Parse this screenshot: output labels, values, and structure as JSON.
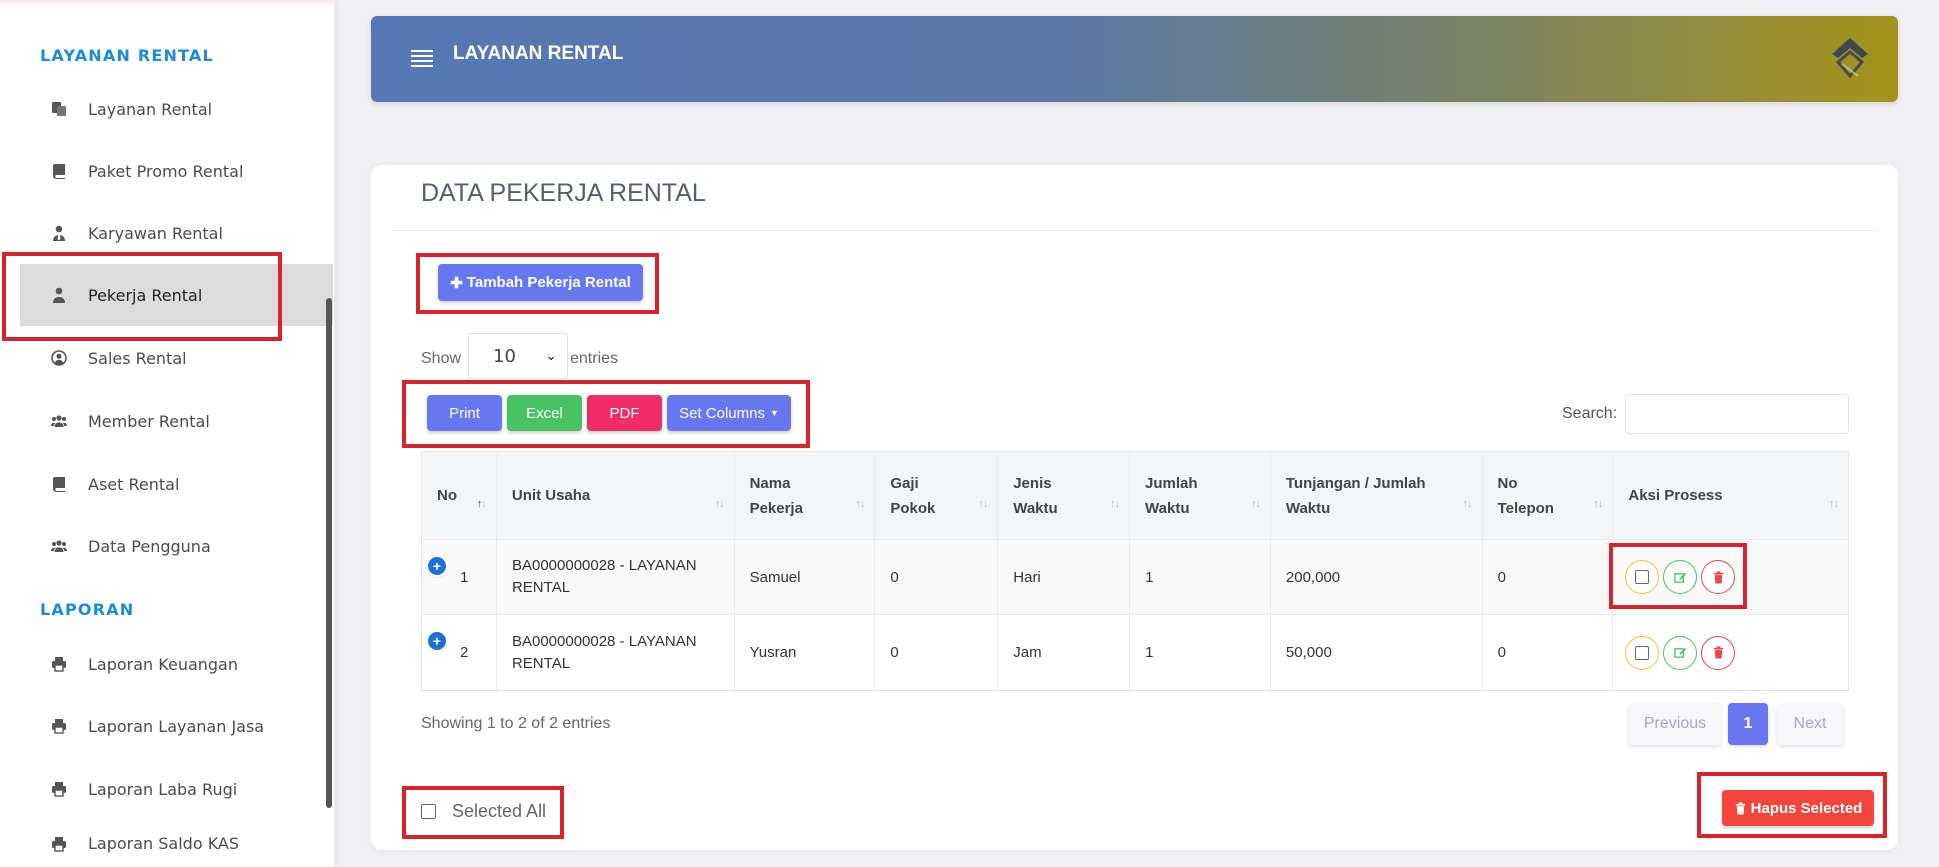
{
  "sidebar": {
    "section_rental": "LAYANAN RENTAL",
    "section_report": "LAPORAN",
    "items": [
      {
        "label": "Layanan Rental",
        "icon": "copy-icon"
      },
      {
        "label": "Paket Promo Rental",
        "icon": "book-icon"
      },
      {
        "label": "Karyawan Rental",
        "icon": "user-tie-icon"
      },
      {
        "label": "Pekerja Rental",
        "icon": "user-icon",
        "active": true
      },
      {
        "label": "Sales Rental",
        "icon": "user-circle-icon"
      },
      {
        "label": "Member Rental",
        "icon": "users-icon"
      },
      {
        "label": "Aset Rental",
        "icon": "book-icon"
      },
      {
        "label": "Data Pengguna",
        "icon": "users-icon"
      }
    ],
    "reports": [
      {
        "label": "Laporan Keuangan",
        "icon": "print-icon"
      },
      {
        "label": "Laporan Layanan Jasa",
        "icon": "print-icon"
      },
      {
        "label": "Laporan Laba Rugi",
        "icon": "print-icon"
      },
      {
        "label": "Laporan Saldo KAS",
        "icon": "print-icon"
      }
    ]
  },
  "header": {
    "title": "LAYANAN RENTAL"
  },
  "card": {
    "title": "DATA PEKERJA RENTAL",
    "add_button": "Tambah Pekerja Rental",
    "show_label": "Show",
    "entries_value": "10",
    "entries_label": "entries",
    "export": {
      "print": "Print",
      "excel": "Excel",
      "pdf": "PDF",
      "columns": "Set Columns"
    },
    "search_label": "Search:",
    "search_value": ""
  },
  "table": {
    "headers": [
      [
        "No"
      ],
      [
        "Unit Usaha"
      ],
      [
        "Nama",
        "Pekerja"
      ],
      [
        "Gaji",
        "Pokok"
      ],
      [
        "Jenis",
        "Waktu"
      ],
      [
        "Jumlah",
        "Waktu"
      ],
      [
        "Tunjangan / Jumlah",
        "Waktu"
      ],
      [
        "No",
        "Telepon"
      ],
      [
        "Aksi Prosess"
      ]
    ],
    "rows": [
      {
        "no": "1",
        "unit_1": "BA0000000028 - LAYANAN",
        "unit_2": "RENTAL",
        "nama": "Samuel",
        "gaji": "0",
        "jenis": "Hari",
        "jumlah": "1",
        "tunjangan": "200,000",
        "telepon": "0"
      },
      {
        "no": "2",
        "unit_1": "BA0000000028 - LAYANAN",
        "unit_2": "RENTAL",
        "nama": "Yusran",
        "gaji": "0",
        "jenis": "Jam",
        "jumlah": "1",
        "tunjangan": "50,000",
        "telepon": "0"
      }
    ]
  },
  "footer": {
    "showing": "Showing 1 to 2 of 2 entries",
    "prev": "Previous",
    "page": "1",
    "next": "Next",
    "select_all": "Selected All",
    "delete_selected": "Hapus Selected"
  },
  "colors": {
    "primary": "#6777ef",
    "success": "#47c363",
    "danger": "#f02c6c",
    "highlight": "#d7232b",
    "accent_blue": "#1f8bd8"
  }
}
